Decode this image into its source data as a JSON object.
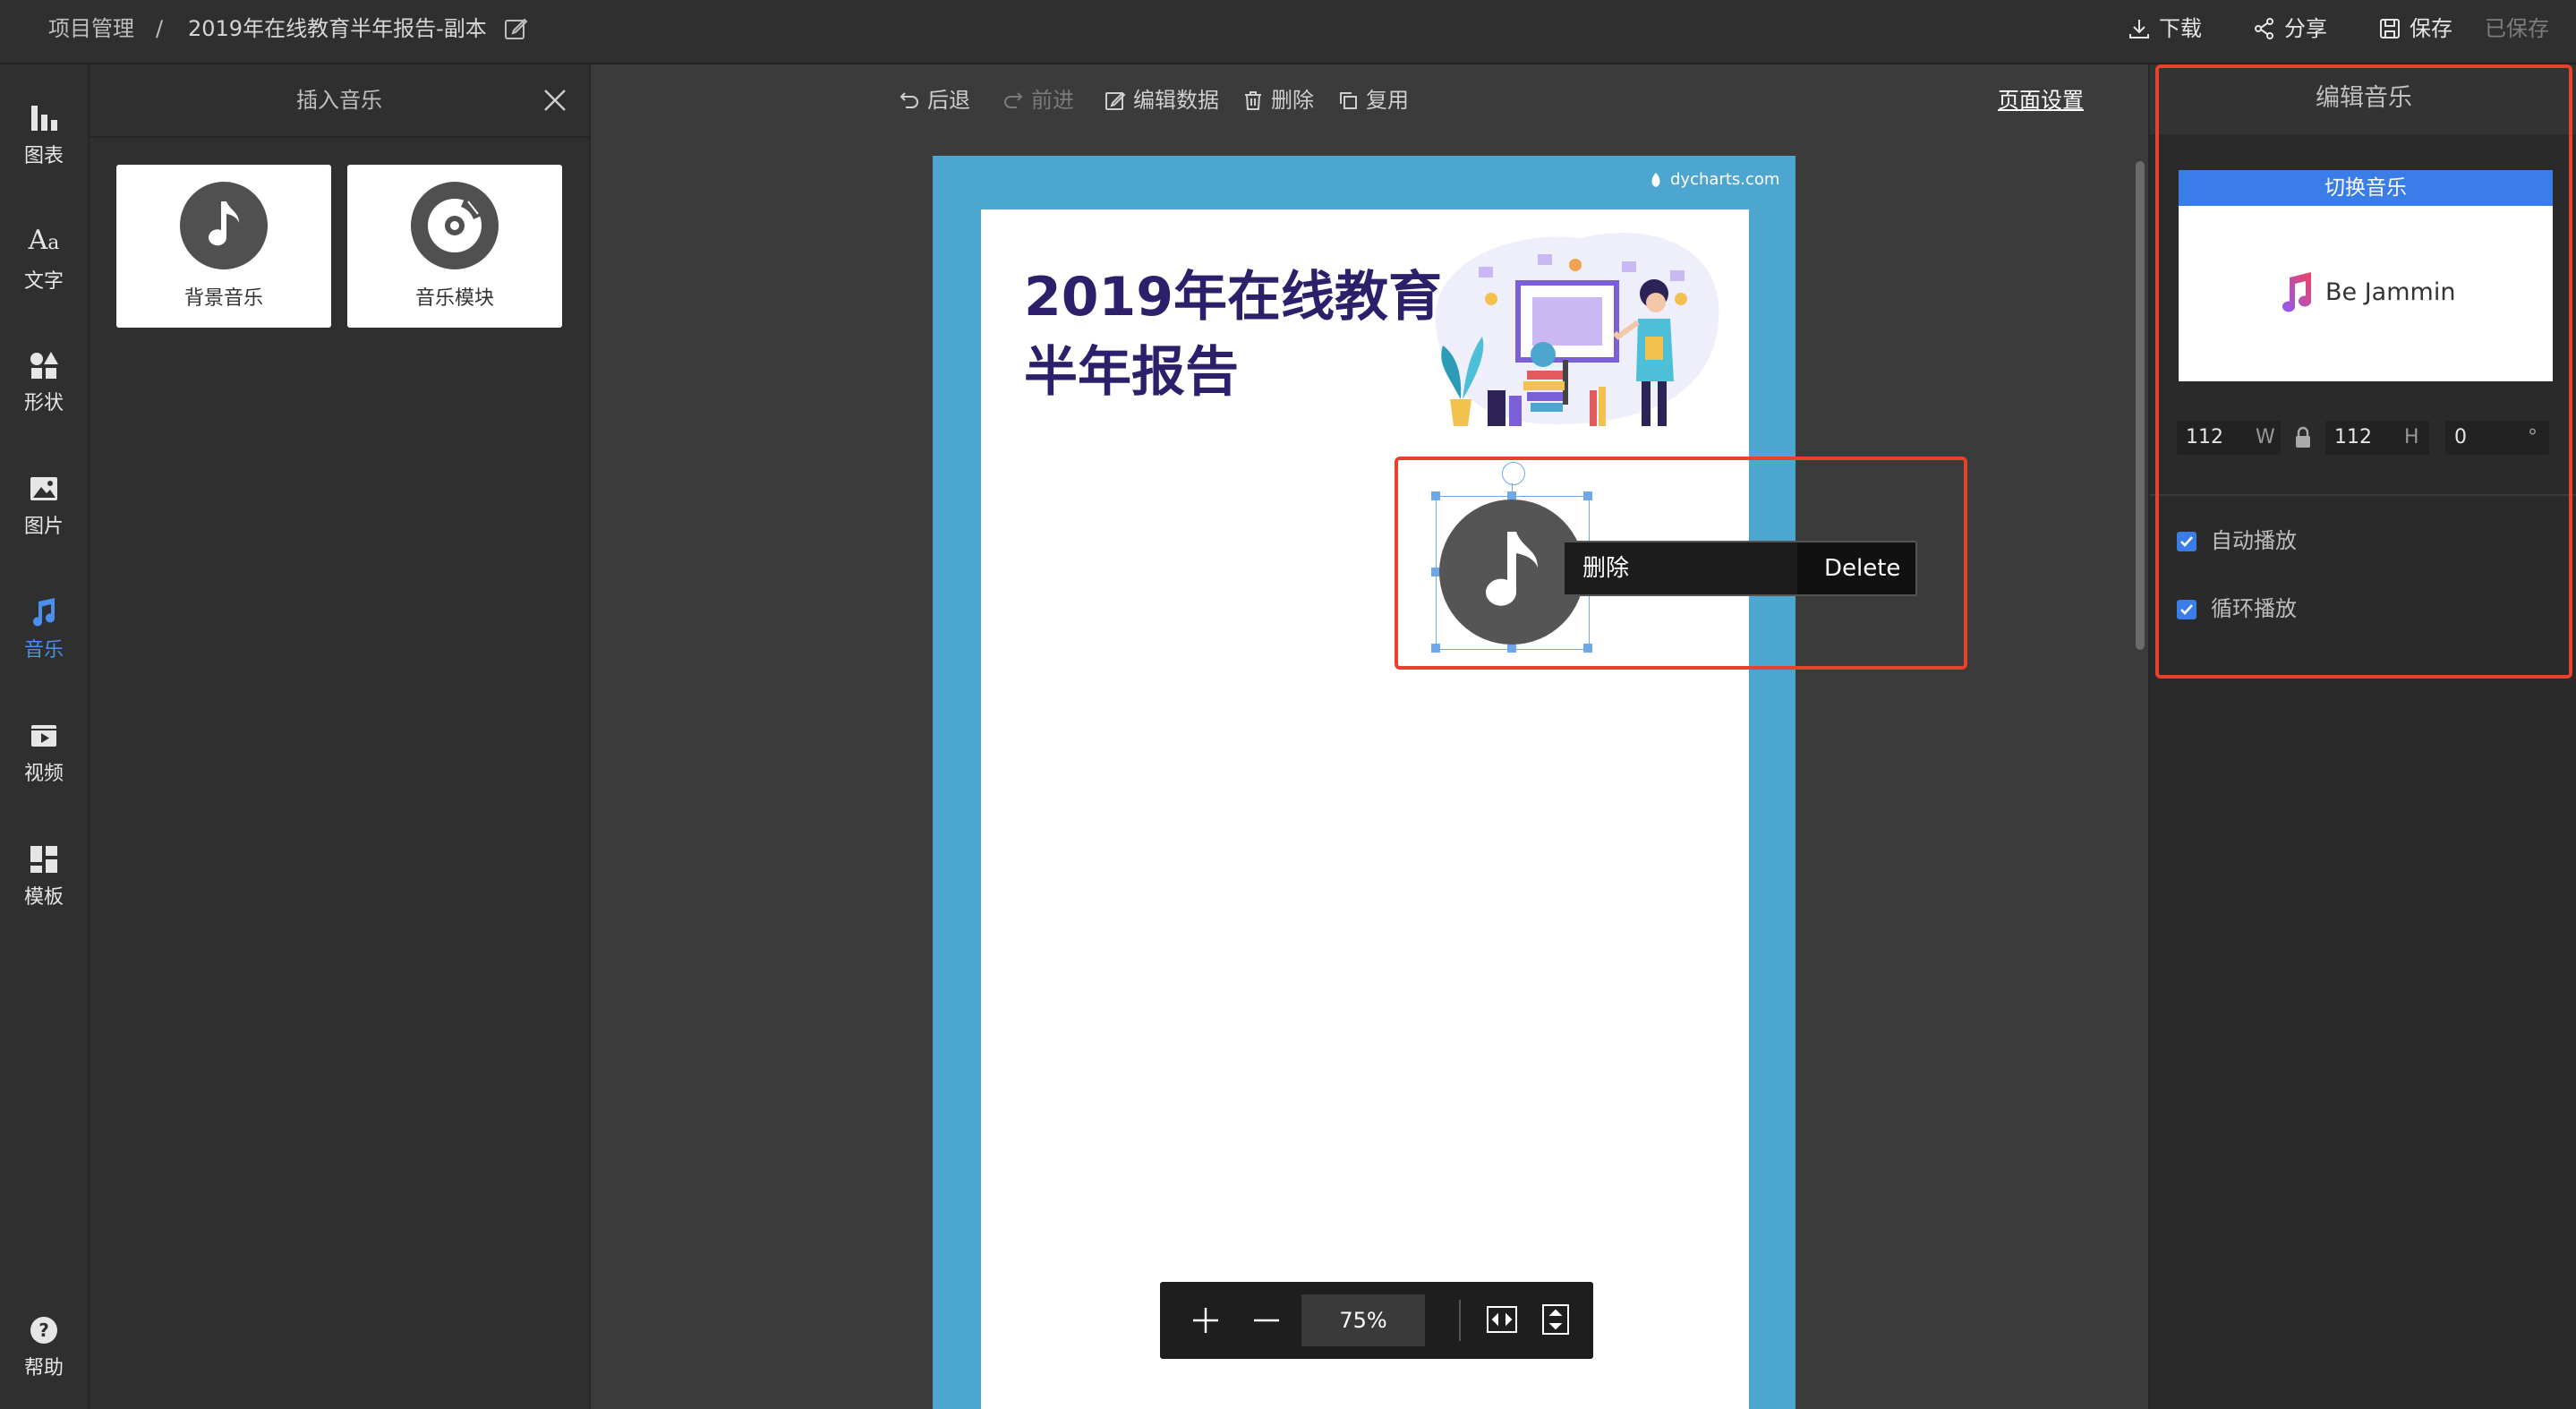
{
  "topbar": {
    "breadcrumb_root": "项目管理",
    "separator": "/",
    "doc_title": "2019年在线教育半年报告-副本",
    "download": "下载",
    "share": "分享",
    "save": "保存",
    "saved": "已保存"
  },
  "rail": {
    "items": [
      {
        "label": "图表",
        "icon": "bar-chart-icon"
      },
      {
        "label": "文字",
        "icon": "text-icon"
      },
      {
        "label": "形状",
        "icon": "shapes-icon"
      },
      {
        "label": "图片",
        "icon": "image-icon"
      },
      {
        "label": "音乐",
        "icon": "music-icon"
      },
      {
        "label": "视频",
        "icon": "video-icon"
      },
      {
        "label": "模板",
        "icon": "template-icon"
      }
    ],
    "help": "帮助"
  },
  "insert_panel": {
    "title": "插入音乐",
    "cards": [
      {
        "label": "背景音乐",
        "icon": "music-note-icon"
      },
      {
        "label": "音乐模块",
        "icon": "music-disc-icon"
      }
    ]
  },
  "toolbar": {
    "undo": "后退",
    "redo": "前进",
    "edit_data": "编辑数据",
    "delete": "删除",
    "duplicate": "复用",
    "page_settings": "页面设置"
  },
  "canvas": {
    "watermark": "dycharts.com",
    "title_line1": "2019年在线教育",
    "title_line2": "半年报告",
    "context_menu": {
      "label": "删除",
      "shortcut": "Delete"
    }
  },
  "zoom": {
    "value": "75%"
  },
  "edit_panel": {
    "title": "编辑音乐",
    "switch_button": "切换音乐",
    "track_name": "Be Jammin",
    "width": "112",
    "width_unit": "W",
    "height": "112",
    "height_unit": "H",
    "rotation": "0",
    "rotation_unit": "°",
    "autoplay": "自动播放",
    "loop": "循环播放"
  },
  "colors": {
    "accent": "#3b7de8",
    "highlight": "#e8412c",
    "title_purple": "#2e1f6b",
    "page_border": "#4da6cf"
  }
}
